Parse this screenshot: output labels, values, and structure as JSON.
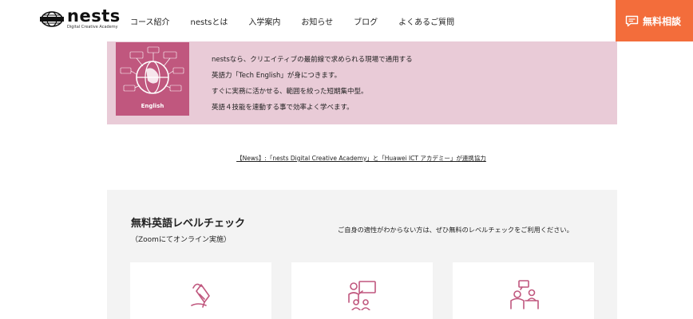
{
  "header": {
    "logo": {
      "name": "nests",
      "tagline": "Digital Creative Academy"
    },
    "nav": [
      {
        "label": "コース紹介"
      },
      {
        "label": "nestsとは"
      },
      {
        "label": "入学案内"
      },
      {
        "label": "お知らせ"
      },
      {
        "label": "ブログ"
      },
      {
        "label": "よくあるご質問"
      }
    ],
    "cta": {
      "label": "無料相談",
      "icon": "chat-bubble-icon",
      "color": "#f36d3b"
    }
  },
  "banner": {
    "background": "#e9cbd7",
    "image": {
      "caption": "English",
      "color": "#c0577e"
    },
    "lines": [
      "nestsなら、クリエイティブの最前線で求められる現場で通用する",
      "英語力「Tech English」が身につきます。",
      "すぐに実務に活かせる、範囲を絞った短期集中型。",
      "英語４技能を連動する事で効率よく学べます。"
    ]
  },
  "news": {
    "text": "【News】:「nests Digital Creative Academy」と「Huawei ICT アカデミー」が連携協力"
  },
  "level_check": {
    "title": "無料英語レベルチェック",
    "subtitle": "（Zoomにてオンライン実施）",
    "description": "ご自身の適性がわからない方は、ぜひ無料のレベルチェックをご利用ください。",
    "cards": [
      {
        "icon": "writing-hand-icon"
      },
      {
        "icon": "presentation-icon"
      },
      {
        "icon": "desk-consultation-icon"
      }
    ],
    "accent": "#c0577e"
  }
}
